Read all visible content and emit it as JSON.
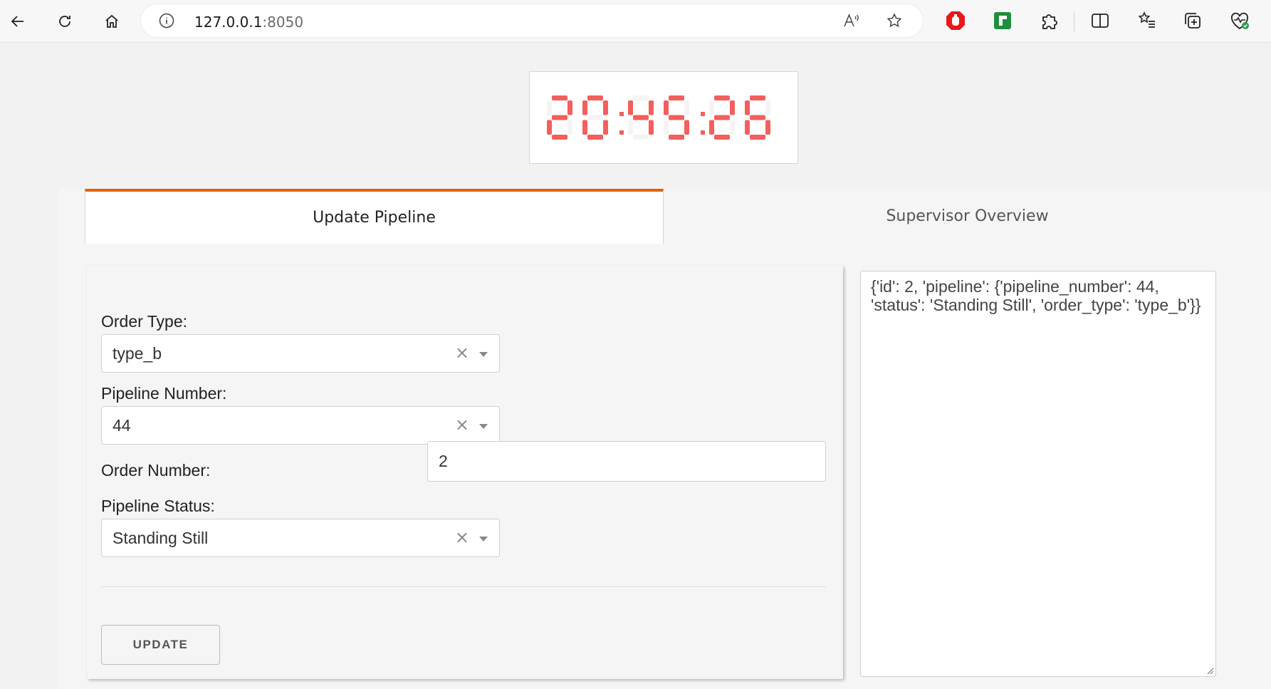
{
  "browser": {
    "url_host": "127.0.0.1",
    "url_port": ":8050",
    "extensions": [
      "adblock-icon",
      "green-extension-icon",
      "puzzle-icon"
    ]
  },
  "clock": {
    "time": "20:45:26",
    "color": "#f25f5c"
  },
  "tabs": [
    {
      "label": "Update Pipeline",
      "active": true
    },
    {
      "label": "Supervisor Overview",
      "active": false
    }
  ],
  "form": {
    "order_type": {
      "label": "Order Type:",
      "value": "type_b"
    },
    "pipeline_number": {
      "label": "Pipeline Number:",
      "value": "44"
    },
    "order_number": {
      "label": "Order Number:",
      "value": "2"
    },
    "pipeline_status": {
      "label": "Pipeline Status:",
      "value": "Standing Still"
    },
    "update_label": "UPDATE",
    "clear_glyph": "×"
  },
  "output": {
    "text": "{'id': 2, 'pipeline': {'pipeline_number': 44, 'status': 'Standing Still', 'order_type': 'type_b'}}"
  },
  "colors": {
    "accent": "#e36209",
    "clock": "#f25f5c"
  }
}
